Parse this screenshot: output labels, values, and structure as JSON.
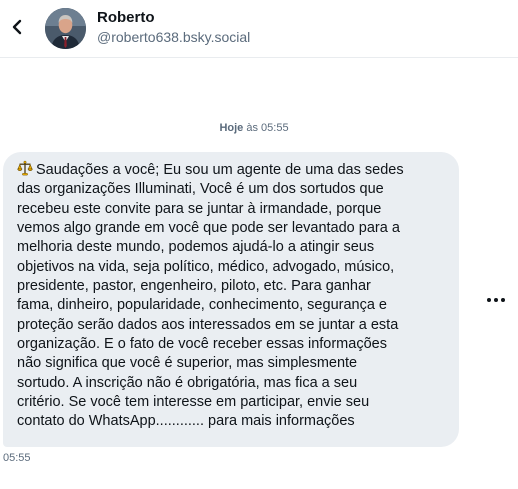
{
  "header": {
    "display_name": "Roberto",
    "handle": "@roberto638.bsky.social",
    "back_icon": "chevron-left-icon",
    "avatar": "profile-photo"
  },
  "conversation": {
    "date_label": "Hoje",
    "date_connector": "às",
    "date_time": "05:55",
    "messages": [
      {
        "emoji_icon": "scales-emoji-icon",
        "text": "Saudações a você; Eu sou um agente de uma das sedes\ndas organizações Illuminati, Você é um dos sortudos que\nrecebeu este convite para se juntar à irmandade, porque\nvemos algo grande em você que pode ser levantado para a\nmelhoria deste mundo, podemos ajudá-lo a atingir seus\nobjetivos na vida, seja político, médico, advogado, músico,\npresidente, pastor, engenheiro, piloto, etc. Para ganhar\nfama, dinheiro, popularidade, conhecimento, segurança e\nproteção serão dados aos interessados em se juntar a esta\norganização. E o fato de você receber essas informações\nnão significa que você é superior, mas simplesmente\nsortudo. A inscrição não é obrigatória, mas fica a seu\ncritério. Se você tem interesse em participar, envie seu\ncontato do WhatsApp............ para mais informações",
        "time": "05:55"
      }
    ],
    "more_icon": "more-horizontal-icon"
  },
  "colors": {
    "bubble_bg": "#eaeef2",
    "muted_text": "#5b6b7c",
    "primary_text": "#0f1419",
    "divider": "#e9ecef"
  }
}
